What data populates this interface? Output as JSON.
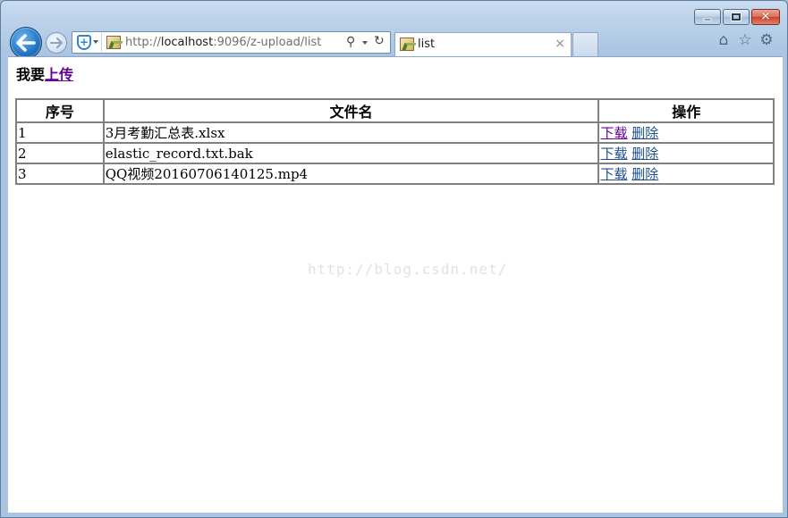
{
  "window": {
    "minimize_icon": "minimize-icon",
    "maximize_icon": "maximize-icon",
    "close_icon": "close-icon",
    "close_glyph": "✕"
  },
  "nav": {
    "back_icon": "back-arrow-icon",
    "forward_icon": "forward-arrow-icon"
  },
  "address": {
    "url_prefix": "http://",
    "url_host": "localhost",
    "url_rest": ":9096/z-upload/list",
    "search_glyph": "⚲",
    "refresh_glyph": "↻"
  },
  "tab": {
    "title": "list",
    "close_glyph": "×"
  },
  "toolbar": {
    "home_glyph": "⌂",
    "favorites_glyph": "☆",
    "tools_glyph": "⚙"
  },
  "page": {
    "heading_prefix": "我要",
    "upload_link": "上传",
    "columns": [
      "序号",
      "文件名",
      "操作"
    ],
    "rows": [
      {
        "index": "1",
        "name": "3月考勤汇总表.xlsx",
        "download": "下载",
        "delete": "删除"
      },
      {
        "index": "2",
        "name": "elastic_record.txt.bak",
        "download": "下载",
        "delete": "删除"
      },
      {
        "index": "3",
        "name": "QQ视频20160706140125.mp4",
        "download": "下载",
        "delete": "删除"
      }
    ]
  },
  "watermark": "http://blog.csdn.net/"
}
